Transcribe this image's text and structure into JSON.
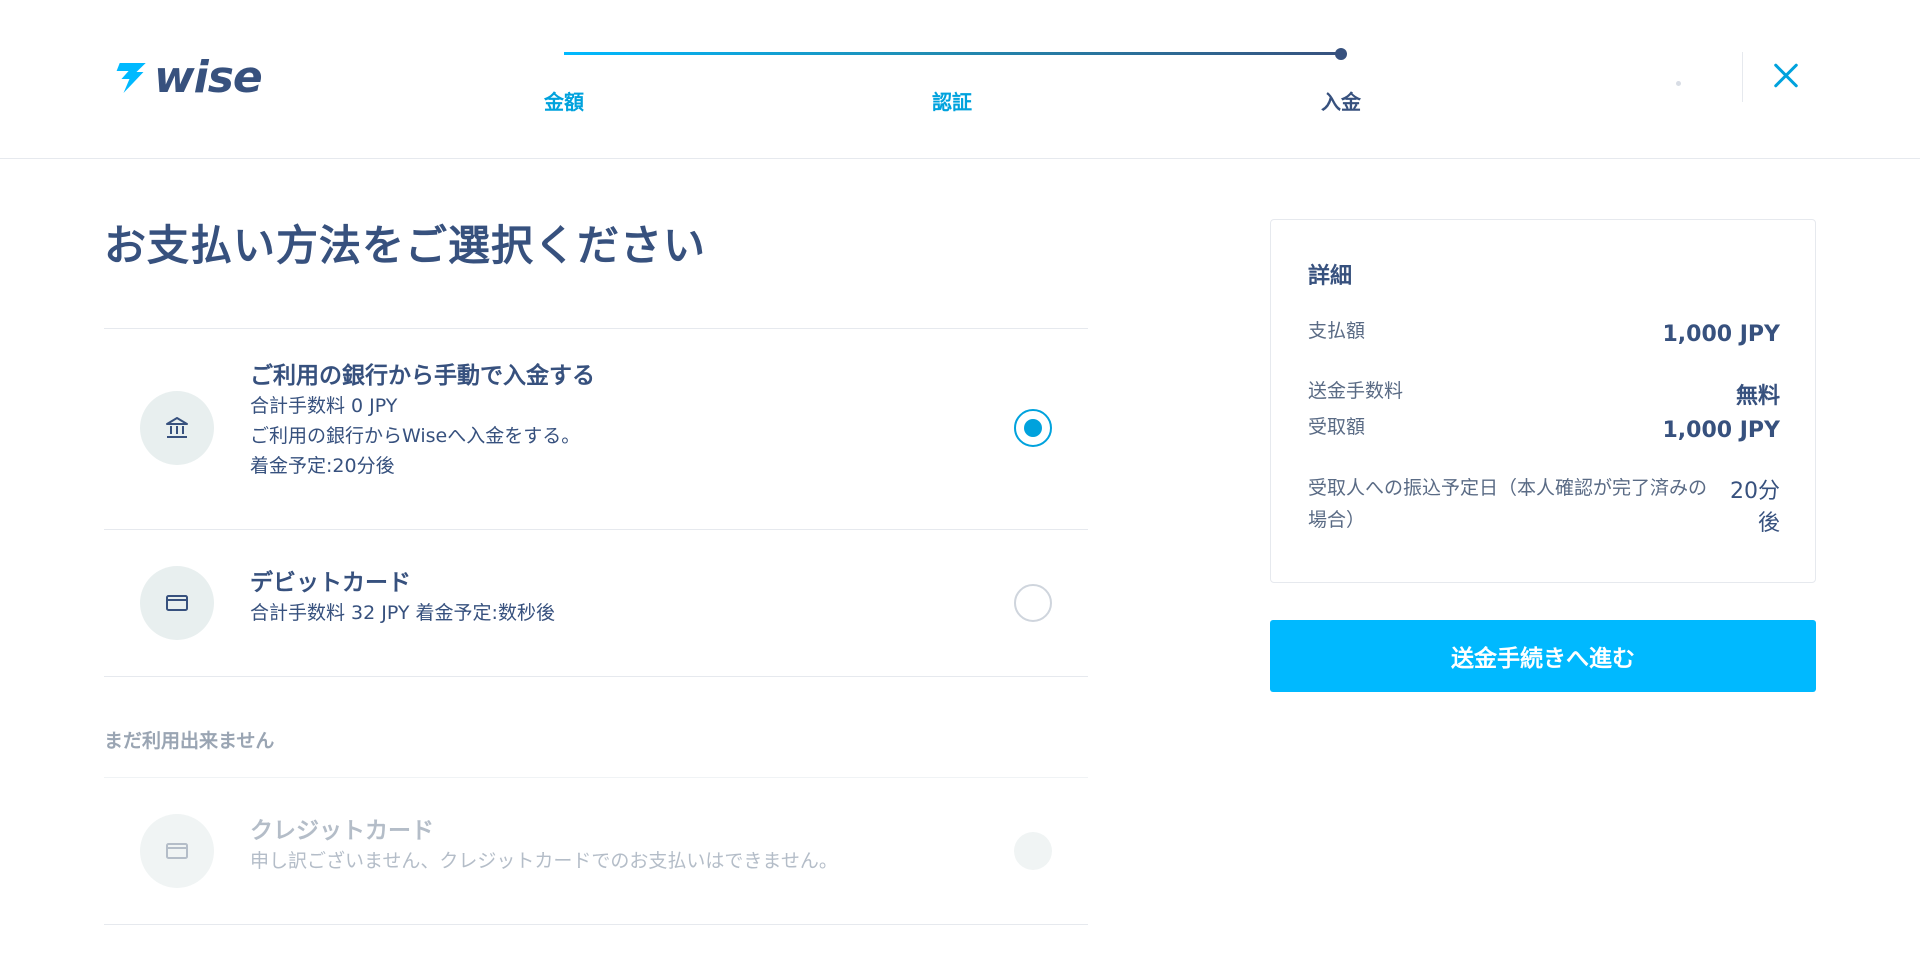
{
  "header": {
    "logo_text": "wise",
    "steps": [
      {
        "label": "金額",
        "state": "done"
      },
      {
        "label": "認証",
        "state": "done"
      },
      {
        "label": "入金",
        "state": "active"
      }
    ],
    "close_icon": "close-icon"
  },
  "main": {
    "title": "お支払い方法をご選択ください",
    "options": [
      {
        "icon": "bank-icon",
        "title": "ご利用の銀行から手動で入金する",
        "lines": [
          "合計手数料 0 JPY",
          "ご利用の銀行からWiseへ入金をする。",
          "着金予定:20分後"
        ],
        "selected": true,
        "enabled": true
      },
      {
        "icon": "card-icon",
        "title": "デビットカード",
        "lines": [
          "合計手数料 32 JPY 着金予定:数秒後"
        ],
        "selected": false,
        "enabled": true
      }
    ],
    "unavailable_label": "まだ利用出来ません",
    "unavailable_options": [
      {
        "icon": "card-icon",
        "title": "クレジットカード",
        "lines": [
          "申し訳ございません、クレジットカードでのお支払いはできません。"
        ],
        "selected": false,
        "enabled": false
      }
    ]
  },
  "details": {
    "title": "詳細",
    "rows": [
      {
        "label": "支払額",
        "value": "1,000 JPY"
      },
      {
        "label": "送金手数料",
        "value": "無料"
      },
      {
        "label": "受取額",
        "value": "1,000 JPY"
      },
      {
        "label": "受取人への振込予定日（本人確認が完了済みの場合）",
        "value": "20分後"
      }
    ]
  },
  "cta": {
    "label": "送金手続きへ進む"
  },
  "colors": {
    "accent": "#00b9ff",
    "accent_text": "#00a2dd",
    "navy": "#37517e",
    "disabled": "#b4bdc8"
  }
}
